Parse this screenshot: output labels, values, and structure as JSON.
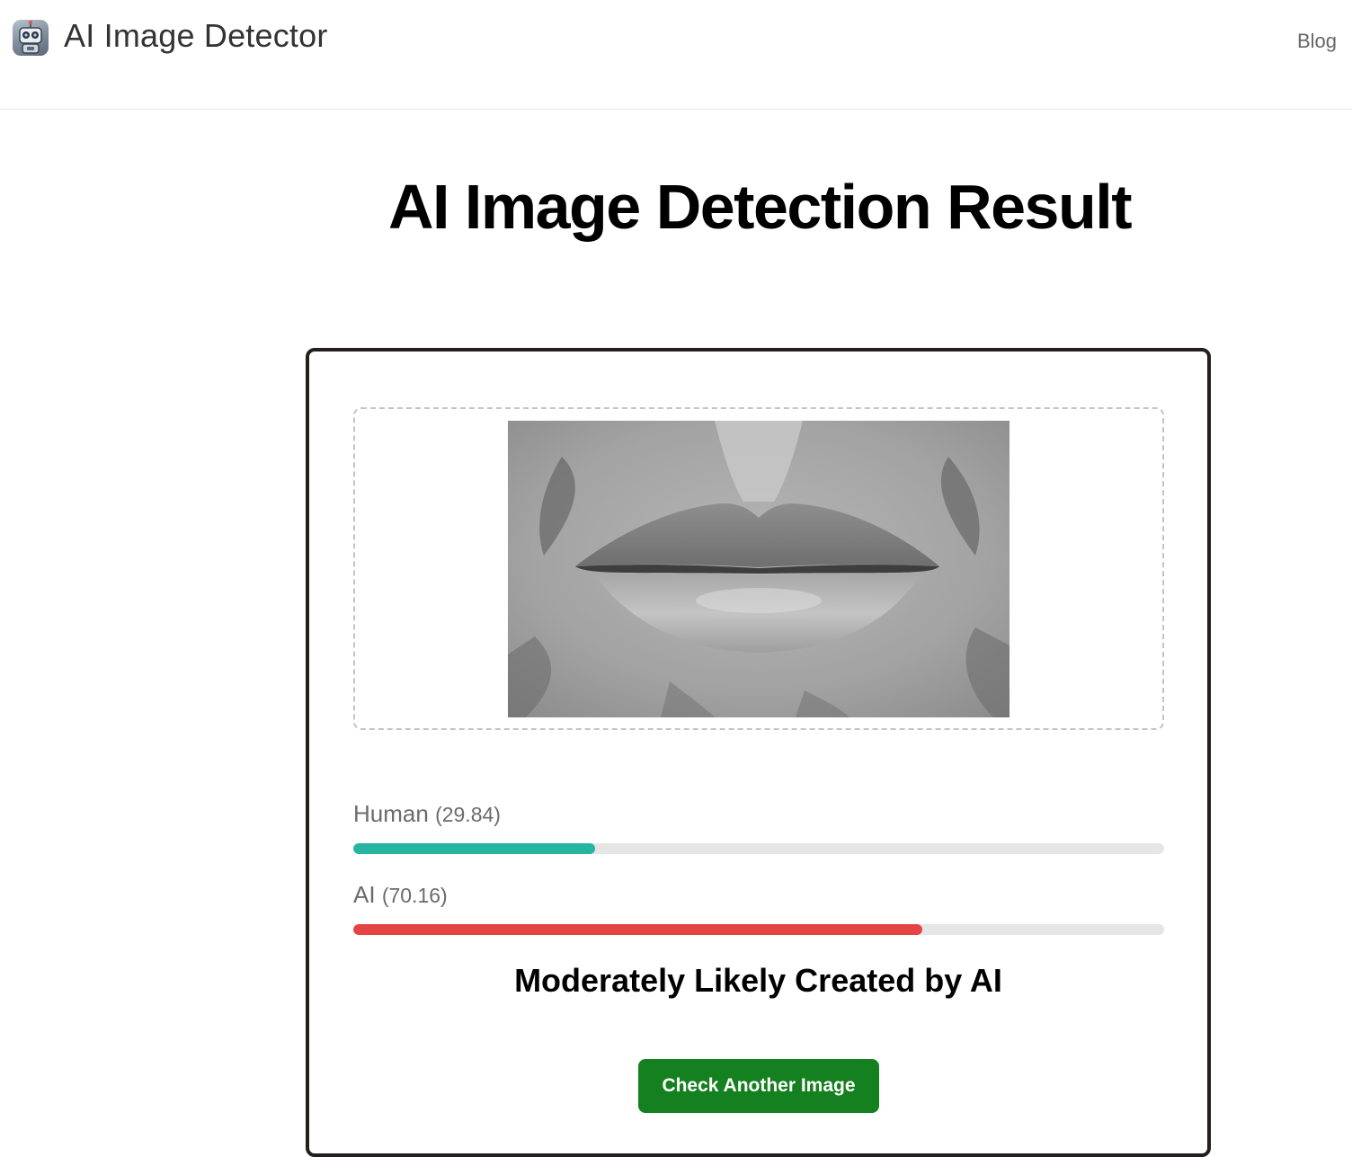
{
  "header": {
    "brand": "AI Image Detector",
    "logo_icon": "robot-icon",
    "nav": {
      "blog_label": "Blog"
    }
  },
  "main": {
    "title": "AI Image Detection Result",
    "preview": {
      "description_icon": "uploaded-image-preview"
    },
    "scores": {
      "human": {
        "label": "Human",
        "value_text": "(29.84)",
        "fraction": 0.2984,
        "color": "#26b5a2"
      },
      "ai": {
        "label": "AI",
        "value_text": "(70.16)",
        "fraction": 0.7016,
        "color": "#e54444"
      }
    },
    "verdict": "Moderately Likely Created by AI",
    "check_button_label": "Check Another Image",
    "colors": {
      "button": "#15801f",
      "card_border": "#241f1c",
      "track": "#e6e6e6"
    }
  }
}
